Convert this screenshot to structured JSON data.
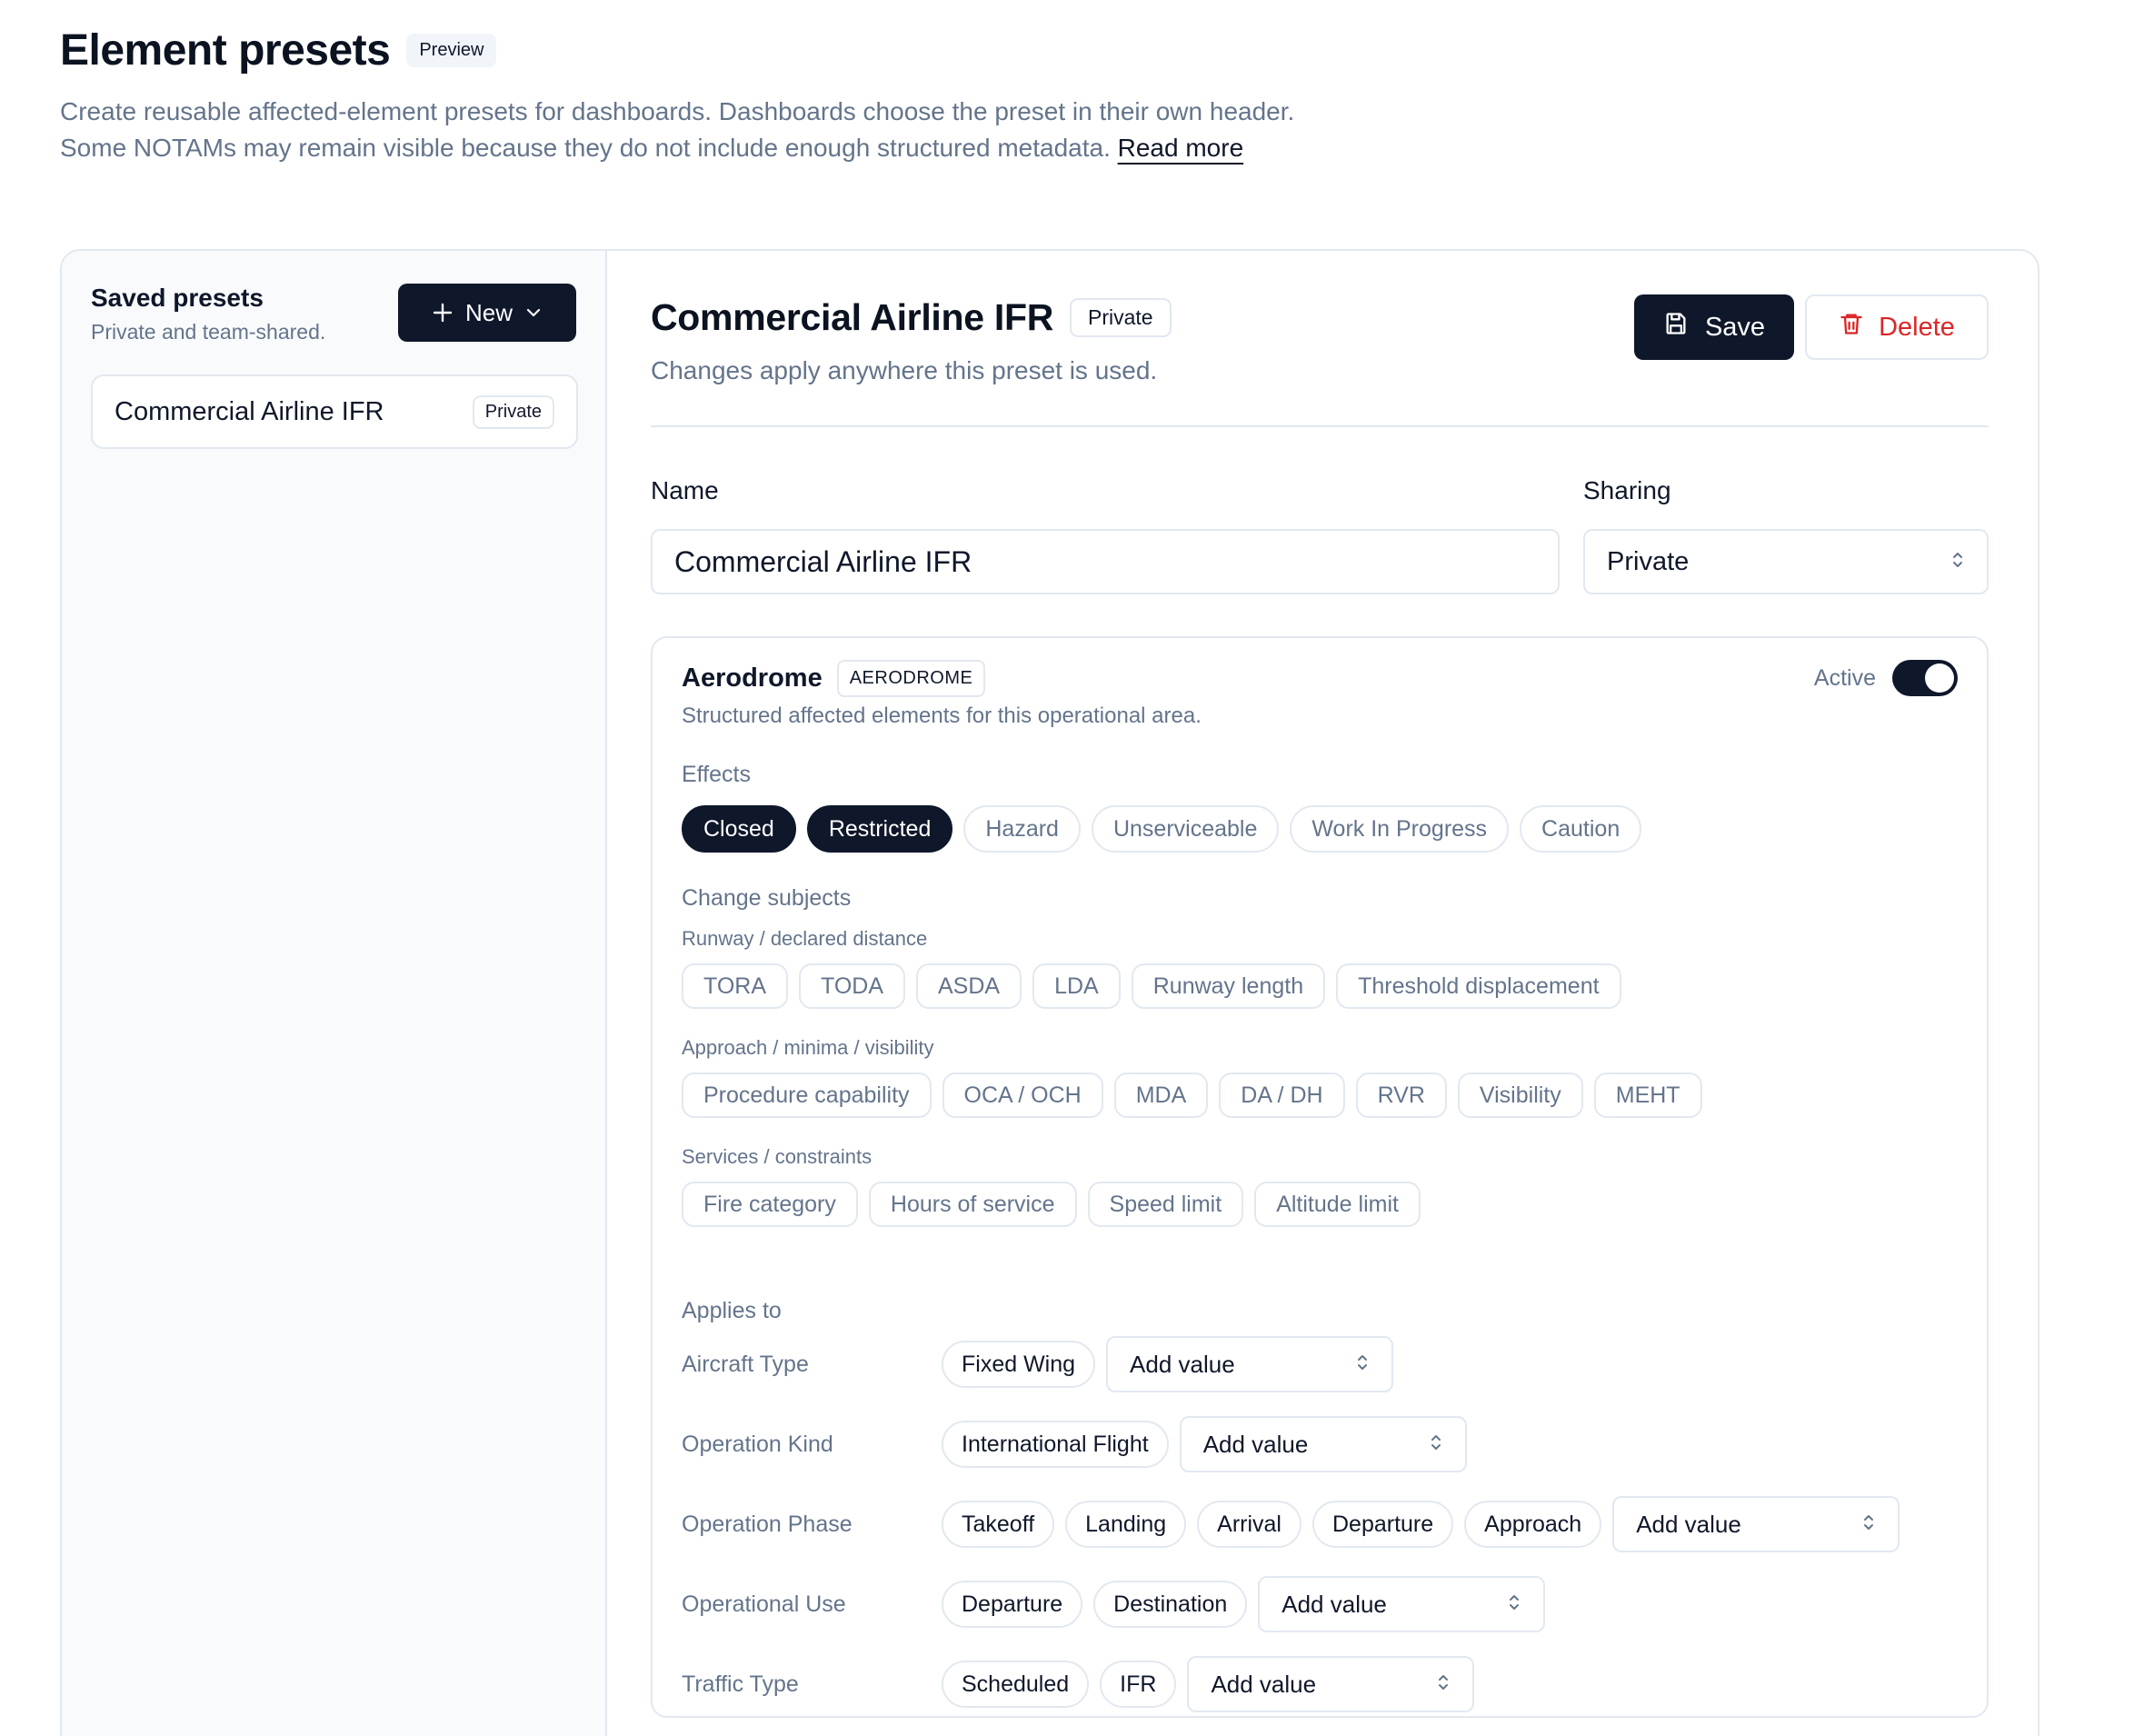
{
  "header": {
    "title": "Element presets",
    "badge": "Preview",
    "description": "Create reusable affected-element presets for dashboards. Dashboards choose the preset in their own header. Some NOTAMs may remain visible because they do not include enough structured metadata.",
    "read_more": "Read more"
  },
  "sidebar": {
    "title": "Saved presets",
    "subtitle": "Private and team-shared.",
    "new_label": "New",
    "presets": [
      {
        "name": "Commercial Airline IFR",
        "visibility": "Private"
      }
    ]
  },
  "detail": {
    "title": "Commercial Airline IFR",
    "visibility_badge": "Private",
    "subtitle": "Changes apply anywhere this preset is used.",
    "save_label": "Save",
    "delete_label": "Delete",
    "name_label": "Name",
    "name_value": "Commercial Airline IFR",
    "sharing_label": "Sharing",
    "sharing_value": "Private"
  },
  "area": {
    "name": "Aerodrome",
    "code": "AERODROME",
    "description": "Structured affected elements for this operational area.",
    "active_label": "Active",
    "effects_label": "Effects",
    "effects": [
      {
        "label": "Closed",
        "selected": true
      },
      {
        "label": "Restricted",
        "selected": true
      },
      {
        "label": "Hazard",
        "selected": false
      },
      {
        "label": "Unserviceable",
        "selected": false
      },
      {
        "label": "Work In Progress",
        "selected": false
      },
      {
        "label": "Caution",
        "selected": false
      }
    ],
    "change_subjects_label": "Change subjects",
    "groups": [
      {
        "label": "Runway / declared distance",
        "items": [
          "TORA",
          "TODA",
          "ASDA",
          "LDA",
          "Runway length",
          "Threshold displacement"
        ]
      },
      {
        "label": "Approach / minima / visibility",
        "items": [
          "Procedure capability",
          "OCA / OCH",
          "MDA",
          "DA / DH",
          "RVR",
          "Visibility",
          "MEHT"
        ]
      },
      {
        "label": "Services / constraints",
        "items": [
          "Fire category",
          "Hours of service",
          "Speed limit",
          "Altitude limit"
        ]
      }
    ],
    "applies_label": "Applies to",
    "add_value_label": "Add value",
    "applies": [
      {
        "label": "Aircraft Type",
        "values": [
          "Fixed Wing"
        ]
      },
      {
        "label": "Operation Kind",
        "values": [
          "International Flight"
        ]
      },
      {
        "label": "Operation Phase",
        "values": [
          "Takeoff",
          "Landing",
          "Arrival",
          "Departure",
          "Approach"
        ]
      },
      {
        "label": "Operational Use",
        "values": [
          "Departure",
          "Destination"
        ]
      },
      {
        "label": "Traffic Type",
        "values": [
          "Scheduled",
          "IFR"
        ]
      }
    ]
  }
}
